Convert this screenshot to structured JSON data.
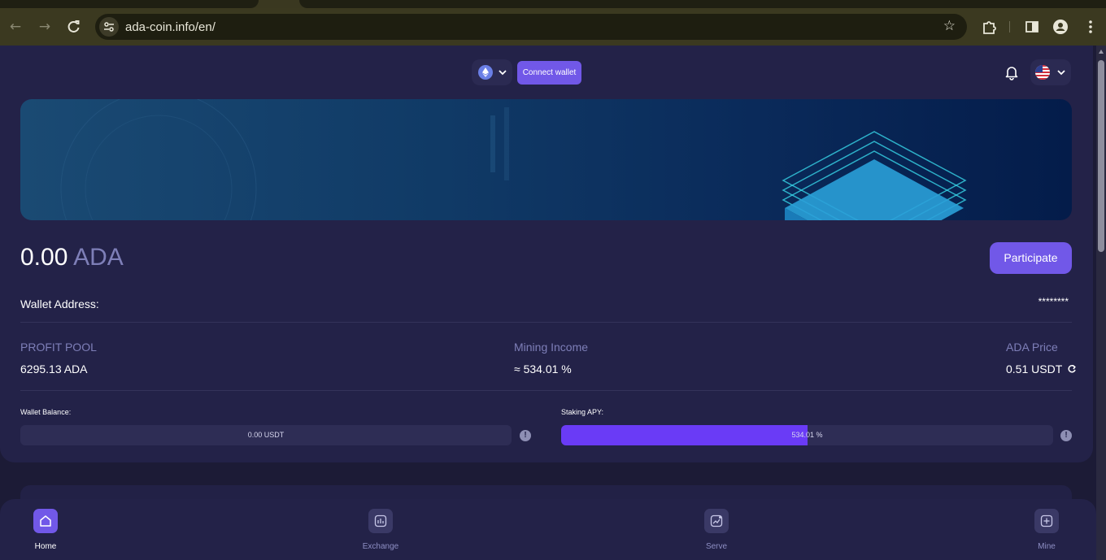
{
  "browser": {
    "url": "ada-coin.info/en/",
    "icons": [
      "back-arrow-icon",
      "forward-arrow-icon",
      "reload-icon",
      "site-settings-icon",
      "bookmark-star-icon",
      "extensions-icon",
      "side-panel-icon",
      "profile-icon",
      "menu-icon"
    ]
  },
  "header": {
    "chain_icon": "ethereum-icon",
    "connect_label": "Connect wallet",
    "bell_icon": "bell-icon",
    "language_icon": "us-flag-icon"
  },
  "balance": {
    "amount": "0.00",
    "unit": "ADA",
    "participate_label": "Participate"
  },
  "wallet": {
    "address_label": "Wallet Address:",
    "address_value": "********"
  },
  "stats": [
    {
      "label": "PROFIT POOL",
      "value": "6295.13 ADA"
    },
    {
      "label": "Mining Income",
      "value": "≈ 534.01 %"
    },
    {
      "label": "ADA Price",
      "value": "0.51 USDT"
    }
  ],
  "bars": {
    "wallet_balance": {
      "label": "Wallet Balance:",
      "text": "0.00 USDT",
      "fill_fraction": 0
    },
    "staking_apy": {
      "label": "Staking APY:",
      "text": "534.01 %",
      "fill_fraction": 0.5
    }
  },
  "bottom_nav": [
    {
      "label": "Home",
      "icon": "home-icon",
      "active": true
    },
    {
      "label": "Exchange",
      "icon": "bar-chart-icon",
      "active": false
    },
    {
      "label": "Serve",
      "icon": "trend-chart-icon",
      "active": false
    },
    {
      "label": "Mine",
      "icon": "plus-square-icon",
      "active": false
    }
  ],
  "colors": {
    "accent": "#7158e8",
    "background": "#1c1b36",
    "card": "#232248",
    "muted_text": "#7e7fb8",
    "progress_fill": "#6a3bf6"
  }
}
